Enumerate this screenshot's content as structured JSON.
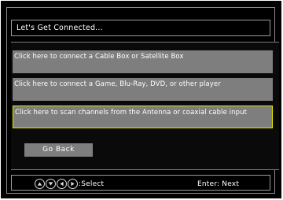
{
  "title": "Let's Get Connected...",
  "options": [
    {
      "label": "Click here to connect a Cable Box or Satellite Box"
    },
    {
      "label": "Click here to connect a Game, Blu-Ray, DVD, or other player"
    },
    {
      "label": "Click here to scan channels from the Antenna or coaxial cable input",
      "selected": true
    }
  ],
  "back_label": "Go Back",
  "footer": {
    "nav_icons": [
      "up-arrow-icon",
      "down-arrow-icon",
      "left-arrow-icon",
      "right-arrow-icon"
    ],
    "select_text": ":Select",
    "enter_text": "Enter: Next"
  },
  "colors": {
    "background": "#000000",
    "option_bg": "#7e7e7e",
    "selection_border": "#e6e600",
    "text": "#ffffff"
  }
}
